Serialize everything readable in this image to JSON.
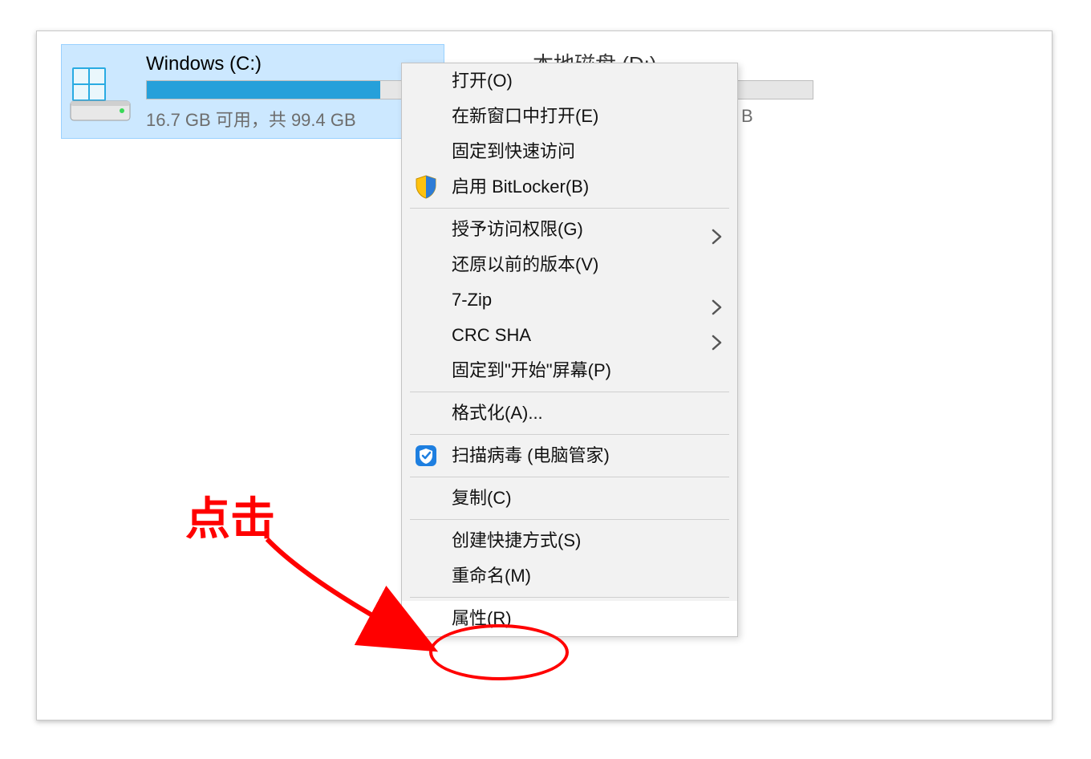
{
  "drive1": {
    "label": "Windows (C:)",
    "info": "16.7 GB 可用，共 99.4 GB",
    "fill_pct": 83
  },
  "drive2": {
    "label_partial": "本地磁盘 (D:)",
    "trailing_char": "B"
  },
  "menu": {
    "items": [
      {
        "label": "打开(O)"
      },
      {
        "label": "在新窗口中打开(E)"
      },
      {
        "label": "固定到快速访问"
      },
      {
        "label": "启用 BitLocker(B)",
        "icon": "shield"
      },
      {
        "sep": true
      },
      {
        "label": "授予访问权限(G)",
        "sub": true
      },
      {
        "label": "还原以前的版本(V)"
      },
      {
        "label": "7-Zip",
        "sub": true
      },
      {
        "label": "CRC SHA",
        "sub": true
      },
      {
        "label": "固定到\"开始\"屏幕(P)"
      },
      {
        "sep": true
      },
      {
        "label": "格式化(A)..."
      },
      {
        "sep": true
      },
      {
        "label": "扫描病毒 (电脑管家)",
        "icon": "guard"
      },
      {
        "sep": true
      },
      {
        "label": "复制(C)"
      },
      {
        "sep": true
      },
      {
        "label": "创建快捷方式(S)"
      },
      {
        "label": "重命名(M)"
      },
      {
        "sep": true
      },
      {
        "label": "属性(R)",
        "highlight": true
      }
    ]
  },
  "annotation": {
    "text": "点击"
  }
}
